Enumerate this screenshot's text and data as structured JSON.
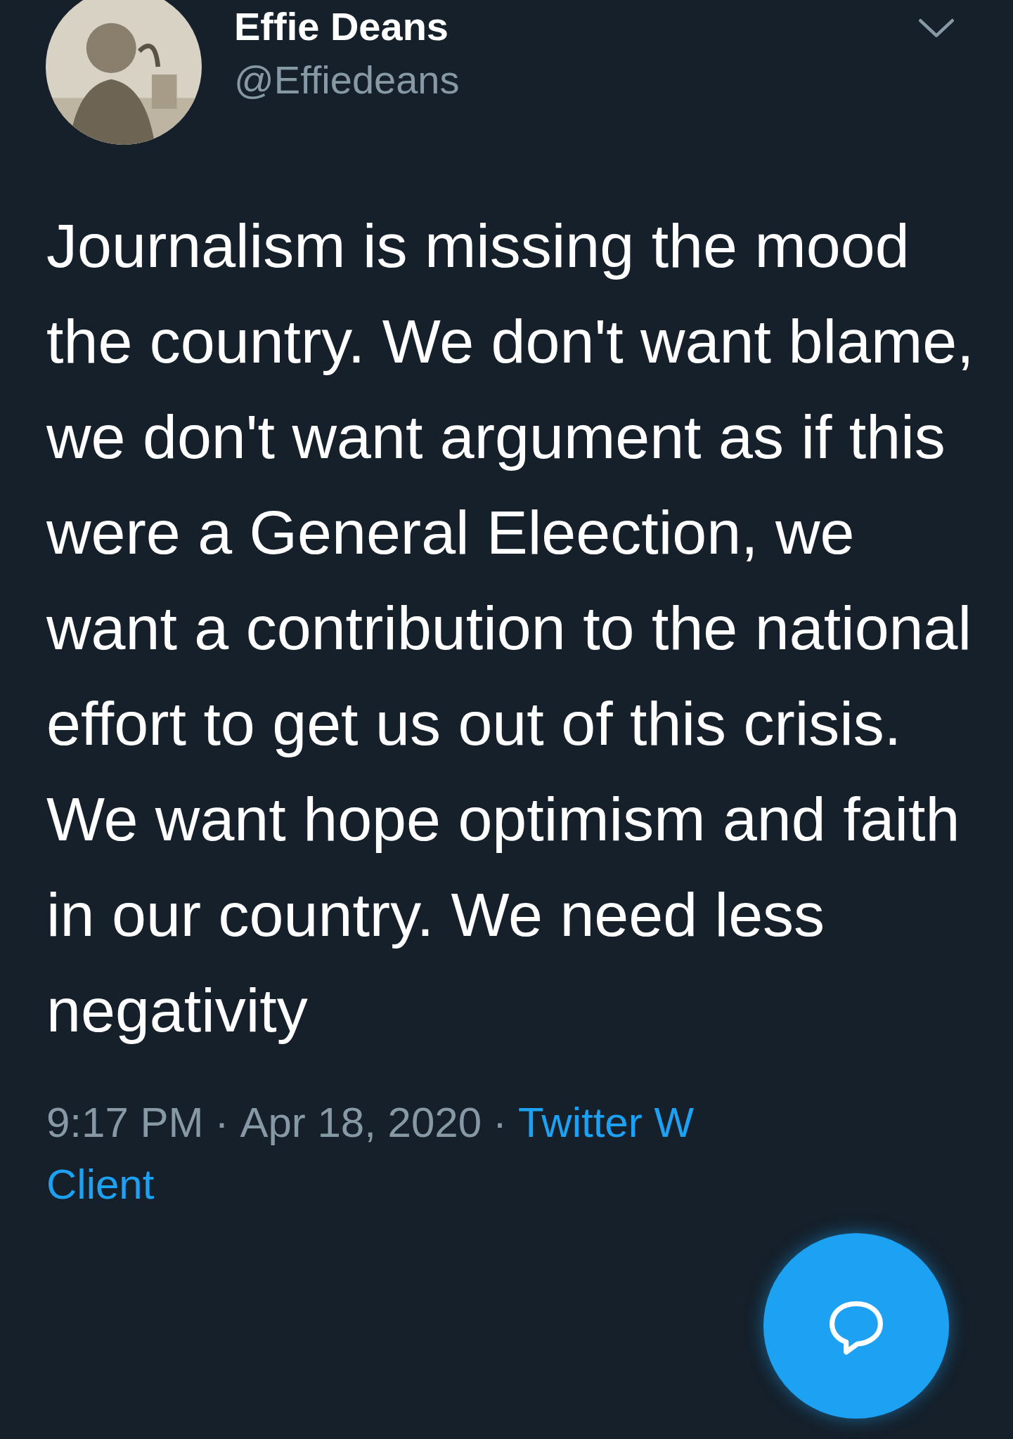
{
  "author": {
    "name": "Effie Deans",
    "handle": "@Effiedeans"
  },
  "text": "Journalism is missing the mood the country. We don't want blame, we don't want argument as if this were a General Eleection, we want a contribution to the national effort to get us out of this crisis. We want hope optimism and faith in our country. We need less negativity",
  "meta": {
    "time": "9:17 PM",
    "separator_1": "·",
    "date": "Apr 18, 2020",
    "separator_2": "·",
    "source": "Twitter W",
    "source_line_2": "Client"
  }
}
